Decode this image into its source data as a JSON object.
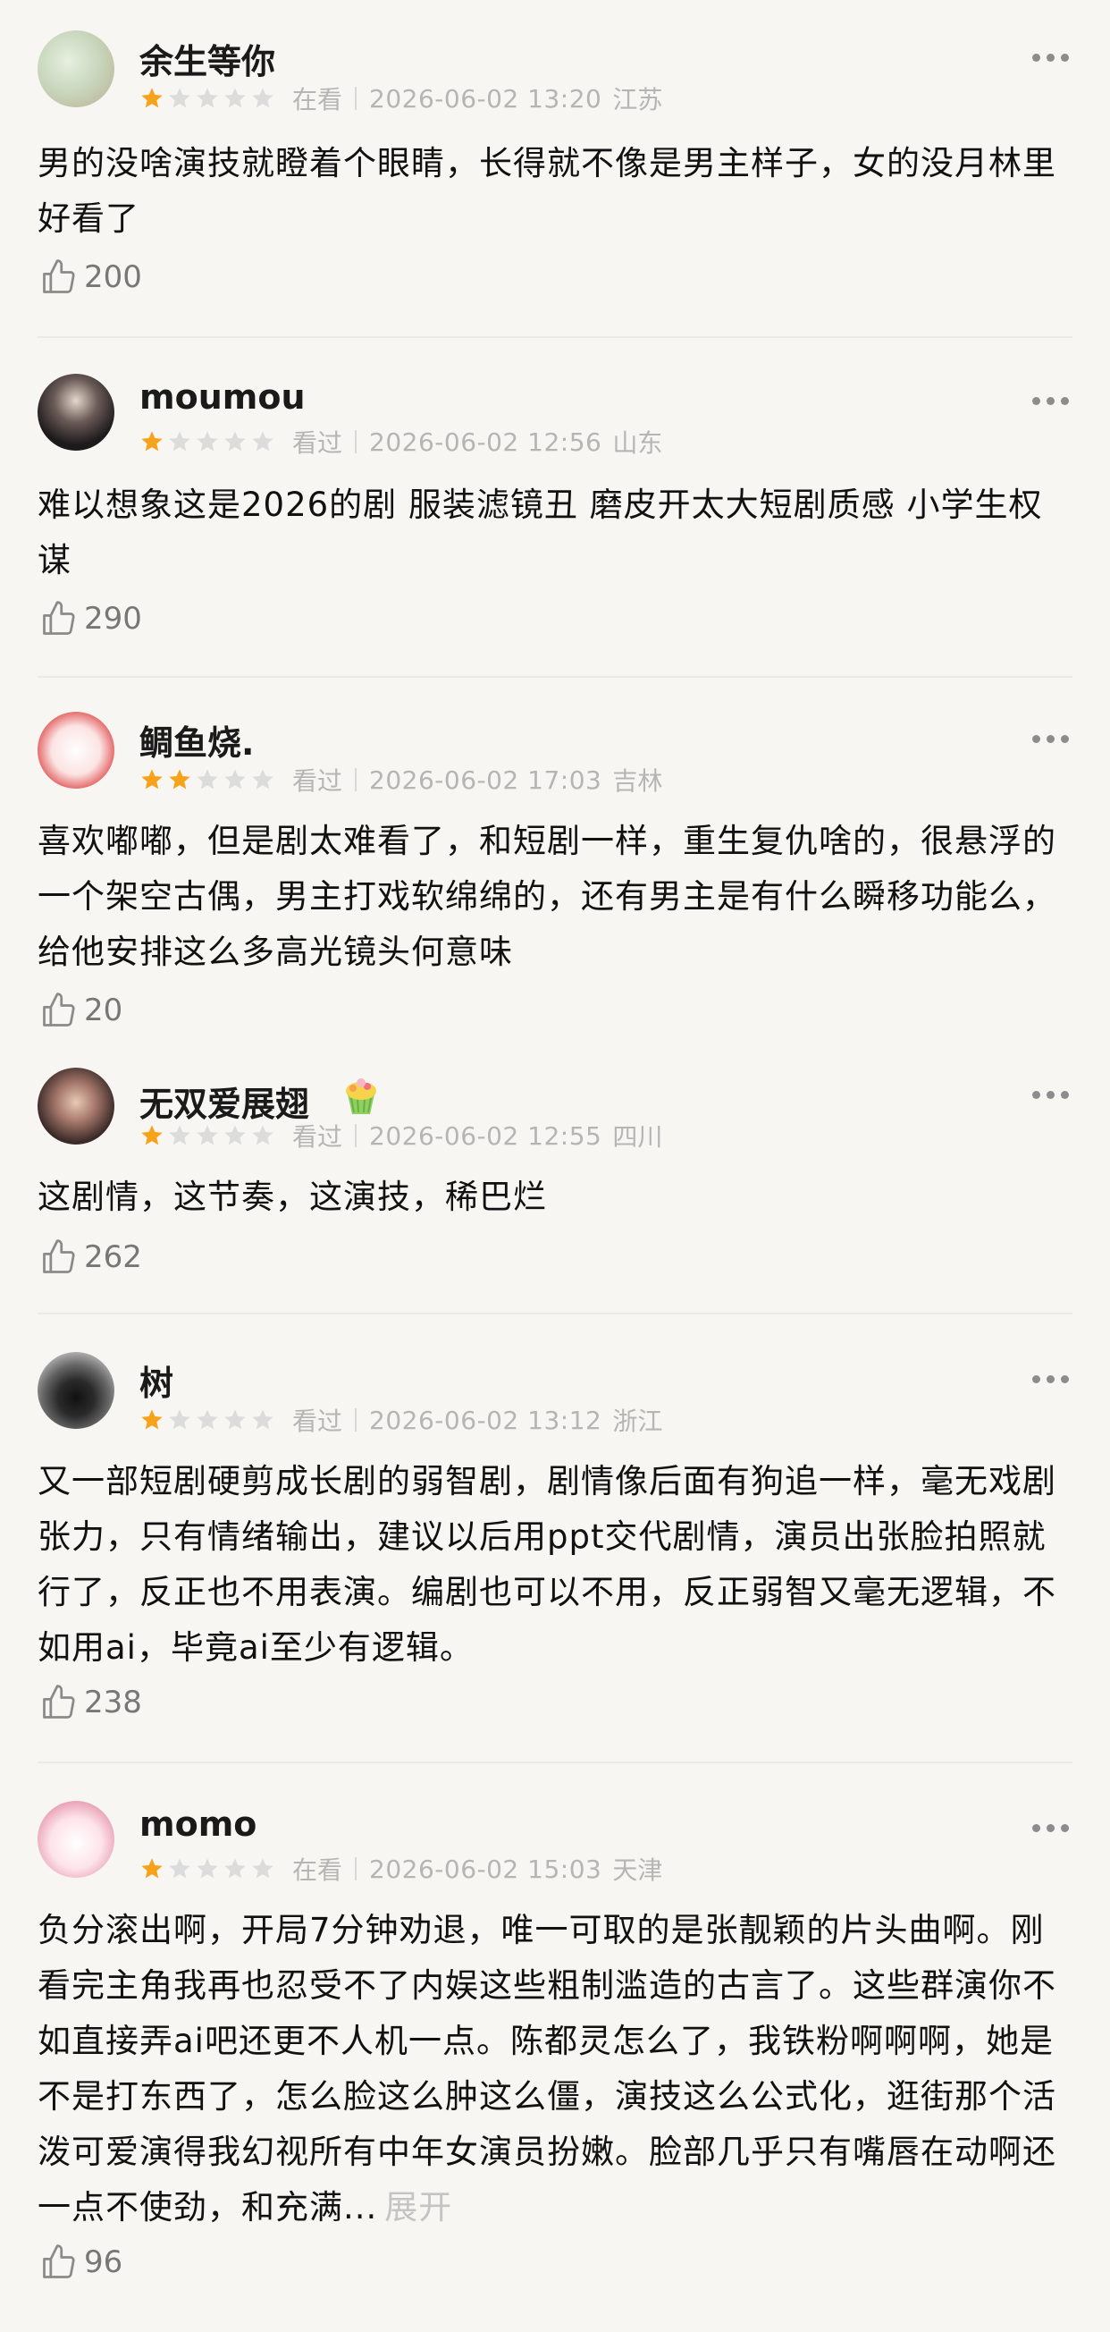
{
  "reviews": [
    {
      "username": "余生等你",
      "rating": 1,
      "status": "在看",
      "timestamp": "2026-06-02 13:20",
      "location": "江苏",
      "text": "男的没啥演技就瞪着个眼睛，长得就不像是男主样子，女的没月林里好看了",
      "likes": "200"
    },
    {
      "username": "moumou",
      "rating": 1,
      "status": "看过",
      "timestamp": "2026-06-02 12:56",
      "location": "山东",
      "text": "难以想象这是2026的剧 服装滤镜丑 磨皮开太大短剧质感 小学生权谋",
      "likes": "290"
    },
    {
      "username": "鲷鱼烧.",
      "rating": 2,
      "status": "看过",
      "timestamp": "2026-06-02 17:03",
      "location": "吉林",
      "text": "喜欢嘟嘟，但是剧太难看了，和短剧一样，重生复仇啥的，很悬浮的一个架空古偶，男主打戏软绵绵的，还有男主是有什么瞬移功能么，给他安排这么多高光镜头何意味",
      "likes": "20"
    },
    {
      "username": "无双爱展翅",
      "rating": 1,
      "status": "看过",
      "timestamp": "2026-06-02 12:55",
      "location": "四川",
      "text": "这剧情，这节奏，这演技，稀巴烂",
      "likes": "262"
    },
    {
      "username": "树",
      "rating": 1,
      "status": "看过",
      "timestamp": "2026-06-02 13:12",
      "location": "浙江",
      "text": "又一部短剧硬剪成长剧的弱智剧，剧情像后面有狗追一样，毫无戏剧张力，只有情绪输出，建议以后用ppt交代剧情，演员出张脸拍照就行了，反正也不用表演。编剧也可以不用，反正弱智又毫无逻辑，不如用ai，毕竟ai至少有逻辑。",
      "likes": "238"
    },
    {
      "username": "momo",
      "rating": 1,
      "status": "在看",
      "timestamp": "2026-06-02 15:03",
      "location": "天津",
      "text": "负分滚出啊，开局7分钟劝退，唯一可取的是张靓颖的片头曲啊。刚看完主角我再也忍受不了内娱这些粗制滥造的古言了。这些群演你不如直接弄ai吧还更不人机一点。陈都灵怎么了，我铁粉啊啊啊，她是不是打东西了，怎么脸这么肿这么僵，演技这么公式化，逛街那个活泼可爱演得我幻视所有中年女演员扮嫩。脸部几乎只有嘴唇在动啊还一点不使劲，和充满...",
      "expand": "展开",
      "likes": "96"
    }
  ],
  "colors": {
    "star_filled": "#f7a21b",
    "star_empty": "#dcdcdc",
    "background": "#f7f6f3"
  }
}
